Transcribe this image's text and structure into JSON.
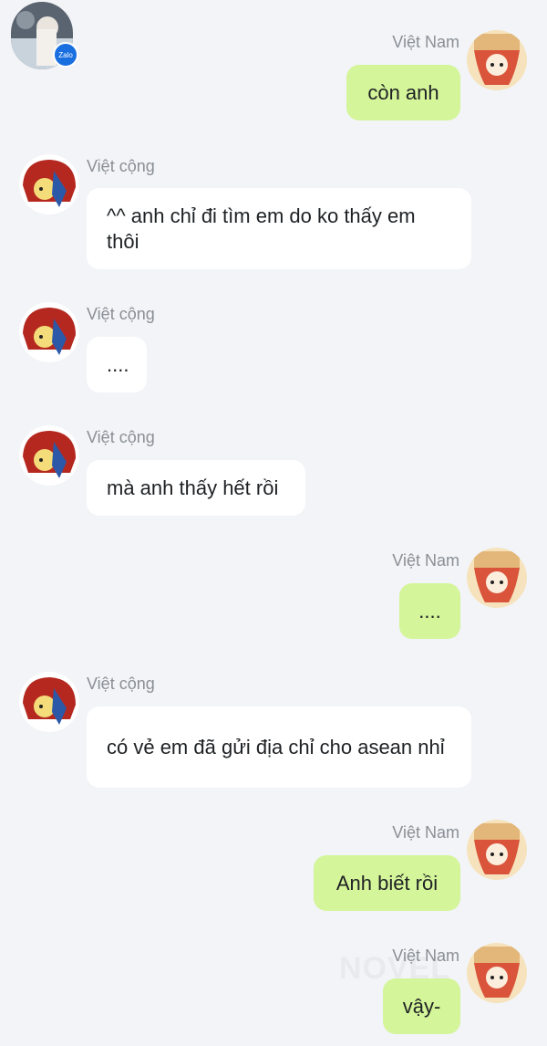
{
  "header": {
    "zalo_badge": "Zalo"
  },
  "contacts": {
    "me": "Việt Nam",
    "other": "Việt cộng"
  },
  "messages": [
    {
      "sender": "Việt Nam",
      "text": "còn anh"
    },
    {
      "sender": "Việt cộng",
      "text": "^^ anh chỉ đi tìm em do ko thấy em thôi"
    },
    {
      "sender": "Việt cộng",
      "text": "...."
    },
    {
      "sender": "Việt cộng",
      "text": "mà anh thấy hết rồi"
    },
    {
      "sender": "Việt Nam",
      "text": "...."
    },
    {
      "sender": "Việt cộng",
      "text": "có vẻ em đã gửi địa chỉ cho asean nhỉ"
    },
    {
      "sender": "Việt Nam",
      "text": "Anh biết rồi"
    },
    {
      "sender": "Việt Nam",
      "text": "vậy-"
    }
  ],
  "watermark": "NOVEL",
  "colors": {
    "background": "#f2f4f7",
    "outgoing_bubble": "#d4f59a",
    "incoming_bubble": "#ffffff"
  }
}
